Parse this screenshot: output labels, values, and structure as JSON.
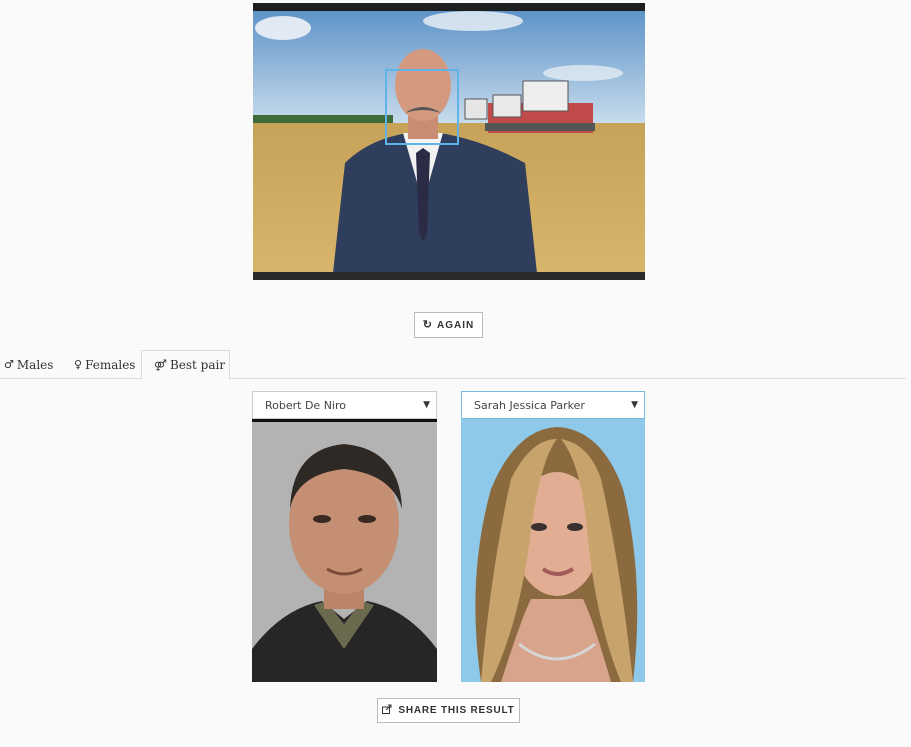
{
  "actions": {
    "again_label": "AGAIN",
    "again_icon": "refresh-icon",
    "share_label": "SHARE THIS RESULT",
    "share_icon": "share-icon"
  },
  "tabs": [
    {
      "label": "Males",
      "icon": "male-symbol-icon",
      "symbol": "♂",
      "active": false
    },
    {
      "label": "Females",
      "icon": "female-symbol-icon",
      "symbol": "♀",
      "active": false
    },
    {
      "label": "Best pair",
      "icon": "pair-symbol-icon",
      "symbol": "⚤",
      "active": true
    }
  ],
  "matches": {
    "left": {
      "selected": "Robert De Niro"
    },
    "right": {
      "selected": "Sarah Jessica Parker"
    }
  },
  "colors": {
    "face_box": "#5fb3e6",
    "page_bg": "#fafafa",
    "active_select_border": "#7ab8e0"
  }
}
